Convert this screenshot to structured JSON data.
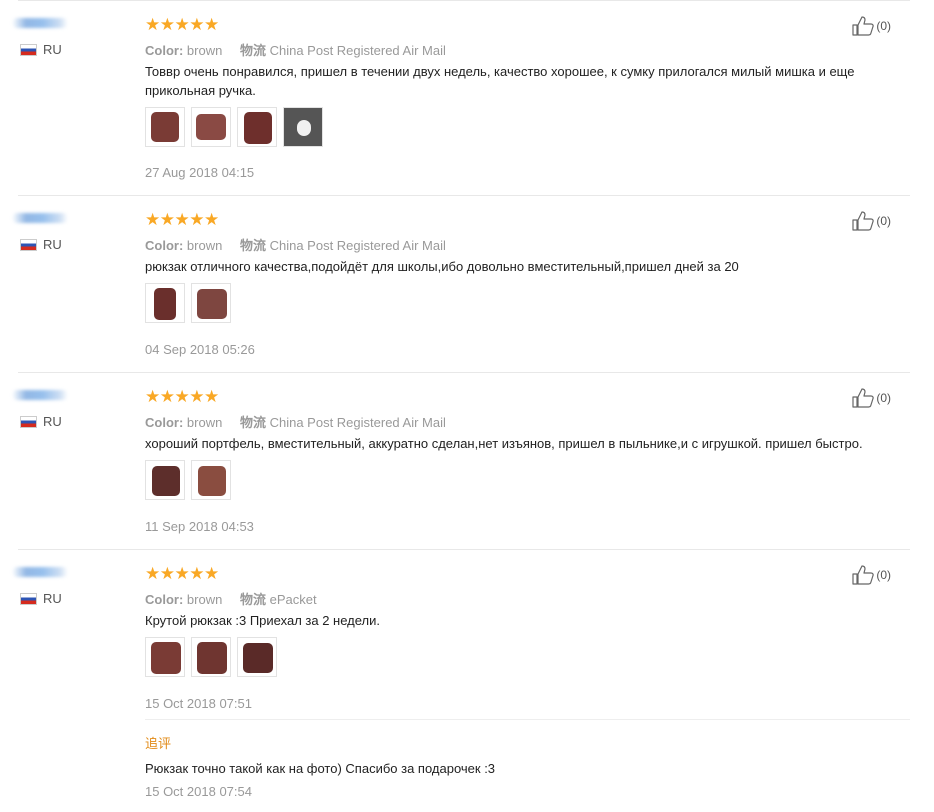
{
  "reviews": [
    {
      "country": "RU",
      "color_label": "Color:",
      "color_value": "brown",
      "shipping_label": "物流",
      "shipping_value": "China Post Registered Air Mail",
      "text": "Товвр очень понравился, пришел в течении двух недель, качество хорошее, к сумку прилогался милый мишка и еще прикольная ручка.",
      "date": "27 Aug 2018 04:15",
      "likes": "(0)",
      "photos": 4
    },
    {
      "country": "RU",
      "color_label": "Color:",
      "color_value": "brown",
      "shipping_label": "物流",
      "shipping_value": "China Post Registered Air Mail",
      "text": "рюкзак отличного качества,подойдёт для школы,ибо довольно вместительный,пришел дней за 20",
      "date": "04 Sep 2018 05:26",
      "likes": "(0)",
      "photos": 2
    },
    {
      "country": "RU",
      "color_label": "Color:",
      "color_value": "brown",
      "shipping_label": "物流",
      "shipping_value": "China Post Registered Air Mail",
      "text": "хороший портфель, вместительный, аккуратно сделан,нет изъянов, пришел в пыльнике,и с игрушкой. пришел быстро.",
      "date": "11 Sep 2018 04:53",
      "likes": "(0)",
      "photos": 2
    },
    {
      "country": "RU",
      "color_label": "Color:",
      "color_value": "brown",
      "shipping_label": "物流",
      "shipping_value": "ePacket",
      "text": "Крутой рюкзак :3 Приехал за 2 недели.",
      "date": "15 Oct 2018 07:51",
      "likes": "(0)",
      "photos": 3,
      "additional_feedback": {
        "label": "追评",
        "text": "Рюкзак точно такой как на фото) Спасибо за подарочек :3",
        "date": "15 Oct 2018 07:54"
      }
    }
  ],
  "stars": "★★★★★",
  "colors": {
    "star": "#f9a825",
    "followup_label": "#e28b18",
    "meta": "#999999",
    "product_brown": "#7a3b35"
  },
  "icons": {
    "like": "thumbs-up-icon",
    "flag": "russia-flag-icon",
    "rating": "star-icon"
  }
}
